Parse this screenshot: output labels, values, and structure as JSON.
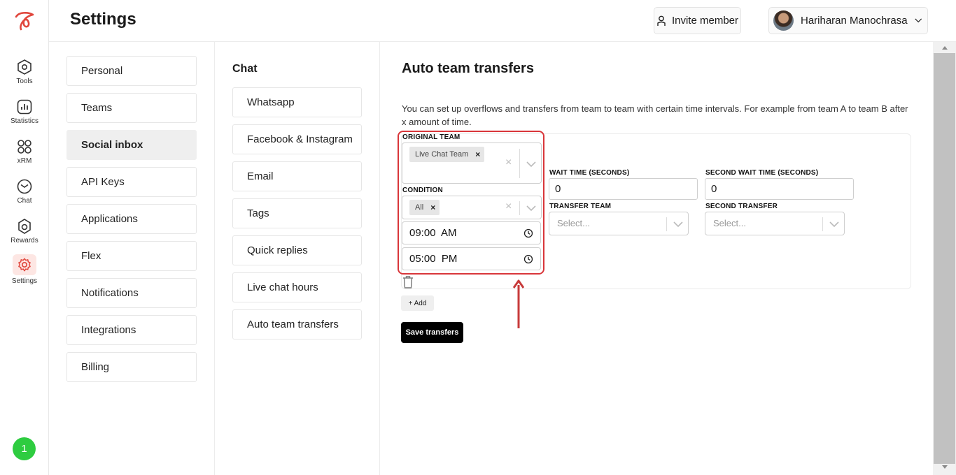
{
  "rail": {
    "items": [
      {
        "label": "Tools",
        "icon": "tools-icon"
      },
      {
        "label": "Statistics",
        "icon": "statistics-icon"
      },
      {
        "label": "xRM",
        "icon": "grid-icon"
      },
      {
        "label": "Chat",
        "icon": "chat-icon"
      },
      {
        "label": "Rewards",
        "icon": "rewards-icon"
      },
      {
        "label": "Settings",
        "icon": "gear-icon"
      }
    ],
    "notification_count": "1",
    "accent_color": "#e0463c"
  },
  "header": {
    "title": "Settings",
    "invite_label": "Invite member",
    "user_name": "Hariharan Manochrasa"
  },
  "settings_menu": [
    "Personal",
    "Teams",
    "Social inbox",
    "API Keys",
    "Applications",
    "Flex",
    "Notifications",
    "Integrations",
    "Billing"
  ],
  "settings_menu_active": "Social inbox",
  "chat_menu": {
    "title": "Chat",
    "items": [
      "Whatsapp",
      "Facebook & Instagram",
      "Email",
      "Tags",
      "Quick replies",
      "Live chat hours",
      "Auto team transfers"
    ]
  },
  "main": {
    "title": "Auto team transfers",
    "description": "You can set up overflows and transfers from team to team with certain time intervals. For example from team A to team B after x amount of time.",
    "original_team_label": "ORIGINAL TEAM",
    "original_team_chip": "Live Chat Team",
    "condition_label": "CONDITION",
    "condition_chip": "All",
    "start_time": "09:00  AM",
    "end_time": "05:00  PM",
    "wait_time_label": "WAIT TIME (SECONDS)",
    "wait_time_value": "0",
    "second_wait_time_label": "SECOND WAIT TIME (SECONDS)",
    "second_wait_time_value": "0",
    "transfer_team_label": "TRANSFER TEAM",
    "transfer_team_placeholder": "Select...",
    "second_transfer_label": "SECOND TRANSFER",
    "second_transfer_placeholder": "Select...",
    "add_label": "+ Add",
    "save_label": "Save transfers",
    "highlight_color": "#d9363a"
  }
}
